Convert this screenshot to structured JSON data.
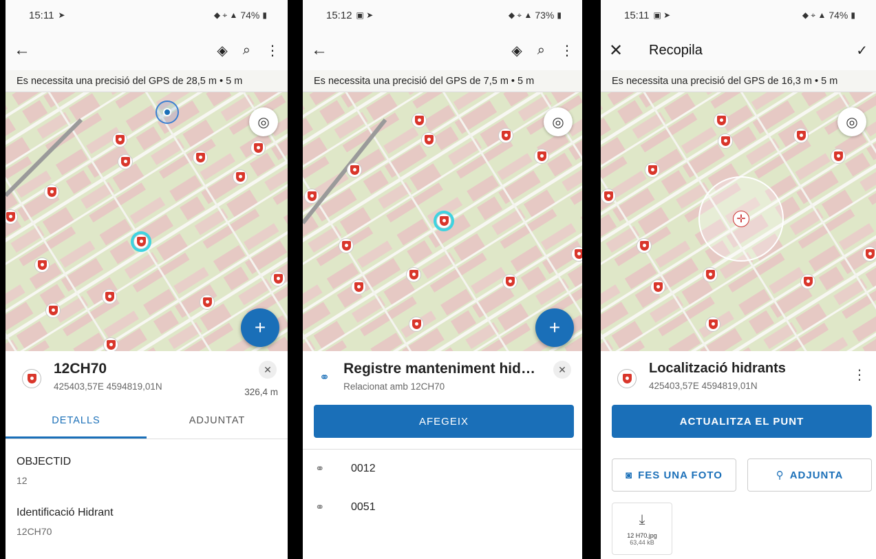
{
  "screen1": {
    "status": {
      "time": "15:11",
      "battery": "74%"
    },
    "gps_text": "Es necessita una precisió del GPS de 28,5 m • 5 m",
    "feature": {
      "title": "12CH70",
      "coords": "425403,57E 4594819,01N",
      "distance": "326,4 m"
    },
    "tabs": [
      "DETALLS",
      "ADJUNTAT"
    ],
    "fields": [
      {
        "label": "OBJECTID",
        "value": "12"
      },
      {
        "label": "Identificació Hidrant",
        "value": "12CH70"
      }
    ]
  },
  "screen2": {
    "status": {
      "time": "15:12",
      "battery": "73%"
    },
    "gps_text": "Es necessita una precisió del GPS de 7,5 m • 5 m",
    "related": {
      "title": "Registre manteniment hid…",
      "subtitle": "Relacionat amb 12CH70"
    },
    "add_button": "AFEGEIX",
    "items": [
      "0012",
      "0051"
    ]
  },
  "screen3": {
    "status": {
      "time": "15:11",
      "battery": "74%"
    },
    "title": "Recopila",
    "gps_text": "Es necessita una precisió del GPS de 16,3 m • 5 m",
    "feature": {
      "title": "Localització hidrants",
      "coords": "425403,57E 4594819,01N"
    },
    "update_button": "ACTUALITZA EL PUNT",
    "photo_button": "FES UNA FOTO",
    "attach_button": "ADJUNTA",
    "attachment": {
      "filename": "12 H70.jpg",
      "size": "63,44 kB"
    }
  },
  "colors": {
    "accent": "#1a6fb8",
    "hydrant": "#d9362b",
    "selection": "#3fd3e0"
  }
}
